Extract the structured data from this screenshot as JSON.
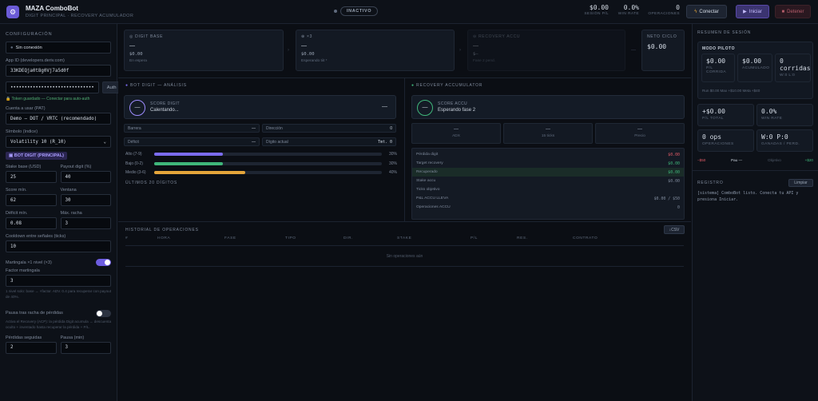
{
  "app": {
    "title": "MAZA ComboBot",
    "subtitle": "DIGIT PRINCIPAL · RECOVERY ACUMULADOR",
    "status": "INACTIVO"
  },
  "header_kpis": [
    {
      "value": "$0.00",
      "label": "SESIÓN P/L"
    },
    {
      "value": "0.0%",
      "label": "WIN RATE"
    },
    {
      "value": "0",
      "label": "OPERACIONES"
    }
  ],
  "header_buttons": {
    "connect": "Conectar",
    "start": "Iniciar",
    "stop": "Detener"
  },
  "config": {
    "title": "CONFIGURACIÓN",
    "connection_status": "Sin conexión",
    "app_id_label": "App ID (developers.deriv.com)",
    "app_id_value": "33KDEQja0t8g0Vj7a5d0f",
    "token_value": "••••••••••••••••••••••••••••••",
    "auth_label": "Auth",
    "token_note": "Token guardado — Conectar para auto-auth",
    "account_label": "Cuenta a usar (PAT)",
    "account_value": "Demo — DOT / VRTC (recomendado)",
    "symbol_label": "Símbolo (índice)",
    "symbol_value": "Volatility 10 (R_10)",
    "section_badge": "BOT DIGIT (PRINCIPAL)",
    "stake_label": "Stake base (USD)",
    "stake_value": "25",
    "payout_label": "Payout digit (%)",
    "payout_value": "40",
    "score_label": "Score mín.",
    "score_value": "62",
    "window_label": "Ventana",
    "window_value": "30",
    "deficit_label": "Déficit mín.",
    "deficit_value": "0.08",
    "streak_label": "Máx. racha",
    "streak_value": "3",
    "cooldown_label": "Cooldown entre señales (ticks)",
    "cooldown_value": "10",
    "martingale_toggle": "Martingala ×1 nivel (×3)",
    "martingale_factor_label": "Factor martingala",
    "martingale_factor_value": "3",
    "martingale_hint": "1 nivel solo: base → ×factor. ADV. 0.4 para recuperar con payout de 40%.",
    "pause_toggle": "Pausa tras racha de pérdidas",
    "pause_hint": "Activa el Recovery (ACP): la pérdida Digit acumula → descuenta oculto + inventado hasta recuperar la pérdida + P/L.",
    "losses_label": "Pérdidas seguidas",
    "losses_value": "2",
    "pause_ticks_label": "Pausa (min)",
    "pause_ticks_value": "3"
  },
  "cards": [
    {
      "title": "◎ DIGIT BASE",
      "value": "—",
      "amount": "$0.00",
      "note": "En espera"
    },
    {
      "title": "⊕ ×3",
      "value": "—",
      "amount": "$0.00",
      "note": "Esperando tiit *"
    },
    {
      "title": "⊖ RECOVERY ACCU",
      "value": "—",
      "amount": "$—",
      "note": "Fase 2 pend."
    },
    {
      "title": "NETO CICLO",
      "value": "$0.00"
    }
  ],
  "digit_panel": {
    "title": "BOT DIGIT — ANÁLISIS",
    "score_label": "SCORE DIGIT",
    "score_value": "Calentando...",
    "ring": "—",
    "score_side": "—",
    "fields": [
      {
        "label": "Barrera",
        "value": "—"
      },
      {
        "label": "Dirección",
        "value": "0"
      },
      {
        "label": "Déficit",
        "value": "—"
      },
      {
        "label": "Dígito actual",
        "value": "Tmt. 0"
      }
    ],
    "bars": [
      {
        "label": "Alto (7-9)",
        "pct": "30%",
        "fill": 0.3,
        "color": "#7b6cf0"
      },
      {
        "label": "Bajo (0-2)",
        "pct": "30%",
        "fill": 0.3,
        "color": "#3fb67a"
      },
      {
        "label": "Medio (3-6)",
        "pct": "40%",
        "fill": 0.4,
        "color": "#e5a53a"
      }
    ],
    "last_label": "ÚLTIMOS 20 DÍGITOS"
  },
  "accu_panel": {
    "title": "RECOVERY ACCUMULATOR",
    "score_label": "SCORE ACCU",
    "score_value": "Esperando fase 2",
    "ring": "—",
    "boxes": [
      {
        "value": "—",
        "label": "ADX"
      },
      {
        "value": "—",
        "label": "15 ticks"
      },
      {
        "value": "—",
        "label": "Precio"
      }
    ],
    "rows": [
      {
        "label": "Pérdida digit",
        "value": "$0.00",
        "color": "#e05a66"
      },
      {
        "label": "Target recovery",
        "value": "$0.00",
        "color": "#3fb67a"
      },
      {
        "label": "Recuperado",
        "value": "$0.00",
        "color": "#3fb67a"
      },
      {
        "label": "Stake accu",
        "value": "$0.00",
        "color": "#9aa5b4"
      },
      {
        "label": "Ticks objetivo",
        "value": "",
        "color": "#9aa5b4"
      },
      {
        "label": "P&L ACCU LLEVA",
        "value": "$0.00 / $50",
        "color": "#9aa5b4"
      },
      {
        "label": "Operaciones ACCU",
        "value": "0",
        "color": "#9aa5b4"
      }
    ]
  },
  "history": {
    "title": "HISTORIAL DE OPERACIONES",
    "csv": "↓CSV",
    "columns": [
      "#",
      "HORA",
      "FASE",
      "TIPO",
      "DIR.",
      "STAKE",
      "P/L",
      "RES.",
      "CONTRATO"
    ],
    "empty": "Sin operaciones aún"
  },
  "summary": {
    "title": "RESUMEN DE SESIÓN",
    "mode": "MODO PILOTO",
    "pilot": [
      {
        "value": "$0.00",
        "label": "P/L CORRIDA"
      },
      {
        "value": "$0.00",
        "label": "ACUMULADO"
      },
      {
        "value": "0 corridas",
        "label": "W:0 L:0"
      }
    ],
    "pilot_footer": "Run $0.00   Max +$10.00   Meta +$40",
    "stats": [
      {
        "value": "+$0.00",
        "label": "P/L TOTAL"
      },
      {
        "value": "0.0%",
        "label": "WIN RATE"
      },
      {
        "value": "0 ops",
        "label": "OPERACIONES"
      },
      {
        "value": "W:0 P:0",
        "label": "GANADAS / PERD."
      }
    ],
    "range": {
      "min": "−$50",
      "center": "Pau —",
      "mid": "Objetivo",
      "max": "+$20"
    },
    "log_title": "REGISTRO",
    "clear": "Limpiar",
    "log_text": "[sistema] ComboBot listo. Conecta tu API y presiona Iniciar."
  }
}
